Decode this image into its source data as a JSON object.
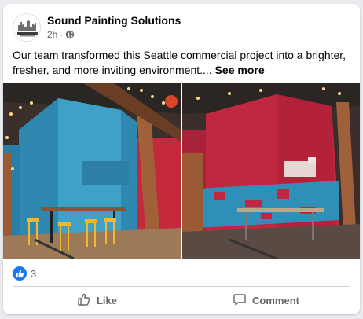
{
  "post": {
    "page_name": "Sound Painting Solutions",
    "time": "2h",
    "separator": "·",
    "privacy_icon": "globe-icon",
    "text": "Our team transformed this Seattle commercial project into a brighter, fresher, and more inviting environment....",
    "see_more": "See more",
    "avatar_text": "SOUND PAINTING SOLUTIONS"
  },
  "images": [
    {
      "label": "after-photo-blue-wall"
    },
    {
      "label": "before-photo-red-wall"
    }
  ],
  "reactions": {
    "icon": "like-icon",
    "count": "3"
  },
  "actions": {
    "like_label": "Like",
    "comment_label": "Comment"
  },
  "colors": {
    "accent": "#1877f2",
    "text": "#050505",
    "secondary": "#65676b"
  }
}
